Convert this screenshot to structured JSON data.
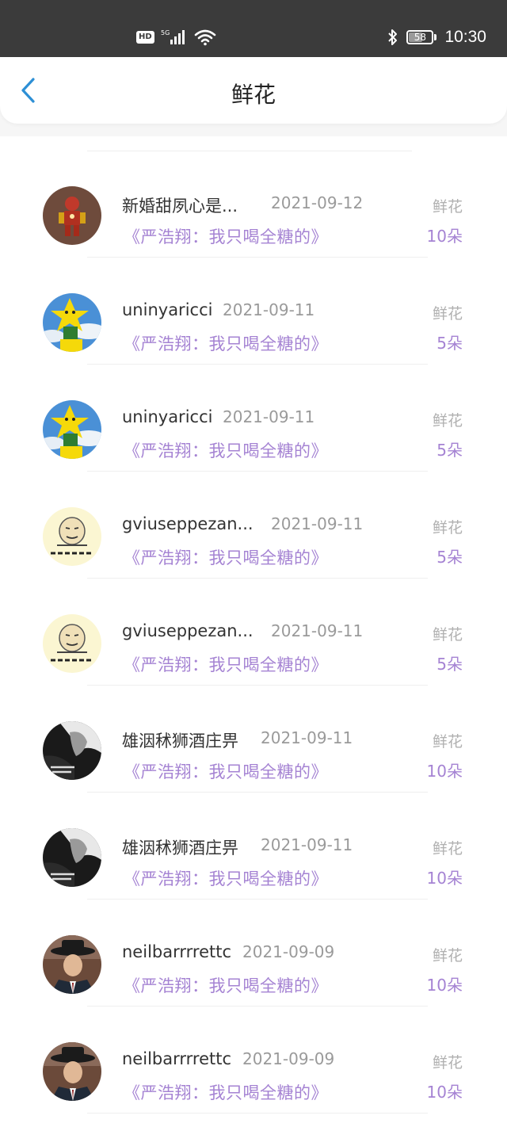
{
  "status_bar": {
    "hd": "HD",
    "network": "5G",
    "battery": "58",
    "time": "10:30",
    "icons": [
      "hd-icon",
      "signal-icon",
      "wifi-icon",
      "bluetooth-icon",
      "battery-icon"
    ]
  },
  "header": {
    "title": "鲜花",
    "back_icon": "chevron-left-icon",
    "accent": "#2d8fd5"
  },
  "colors": {
    "song": "#a583d3",
    "count": "#a583d3",
    "gift": "#b0b0b0",
    "date": "#9a9a9a"
  },
  "records": [
    {
      "name": "新婚甜夙心是...",
      "date": "2021-09-12",
      "song": "《严浩翔：我只喝全糖的》",
      "gift": "鲜花",
      "count": "10朵",
      "avatar": "iron-man-figure"
    },
    {
      "name": "uninyaricci",
      "date": "2021-09-11",
      "song": "《严浩翔：我只喝全糖的》",
      "gift": "鲜花",
      "count": "5朵",
      "avatar": "yellow-star-toy"
    },
    {
      "name": "uninyaricci",
      "date": "2021-09-11",
      "song": "《严浩翔：我只喝全糖的》",
      "gift": "鲜花",
      "count": "5朵",
      "avatar": "yellow-star-toy"
    },
    {
      "name": "gviuseppezan...",
      "date": "2021-09-11",
      "song": "《严浩翔：我只喝全糖的》",
      "gift": "鲜花",
      "count": "5朵",
      "avatar": "meme-face"
    },
    {
      "name": "gviuseppezan...",
      "date": "2021-09-11",
      "song": "《严浩翔：我只喝全糖的》",
      "gift": "鲜花",
      "count": "5朵",
      "avatar": "meme-face"
    },
    {
      "name": "雄洇秫狮酒庄畀",
      "date": "2021-09-11",
      "song": "《严浩翔：我只喝全糖的》",
      "gift": "鲜花",
      "count": "10朵",
      "avatar": "bw-portrait"
    },
    {
      "name": "雄洇秫狮酒庄畀",
      "date": "2021-09-11",
      "song": "《严浩翔：我只喝全糖的》",
      "gift": "鲜花",
      "count": "10朵",
      "avatar": "bw-portrait"
    },
    {
      "name": "neilbarrrrettc",
      "date": "2021-09-09",
      "song": "《严浩翔：我只喝全糖的》",
      "gift": "鲜花",
      "count": "10朵",
      "avatar": "hat-man"
    },
    {
      "name": "neilbarrrrettc",
      "date": "2021-09-09",
      "song": "《严浩翔：我只喝全糖的》",
      "gift": "鲜花",
      "count": "10朵",
      "avatar": "hat-man"
    }
  ]
}
